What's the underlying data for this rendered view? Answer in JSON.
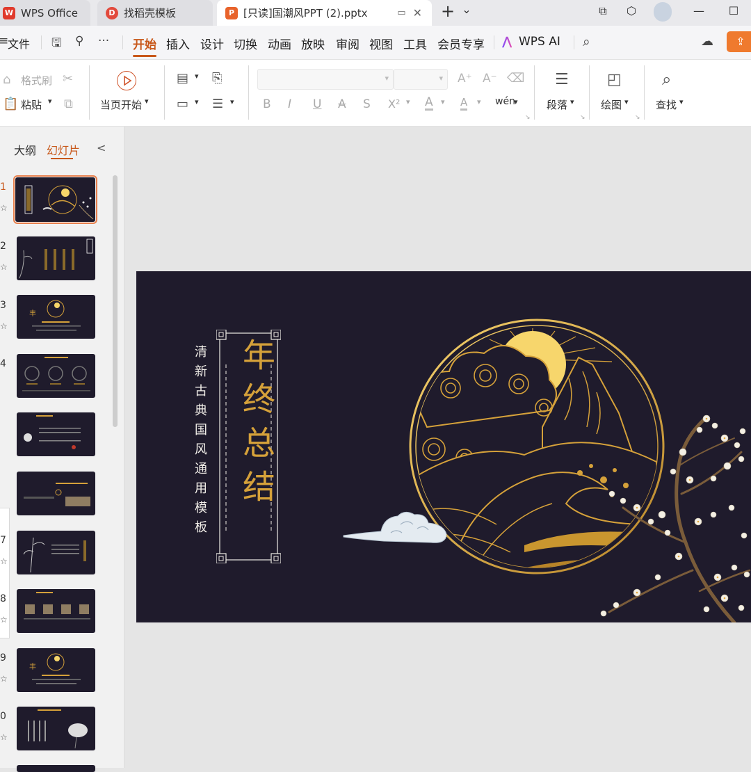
{
  "tabs": [
    {
      "label": "WPS Office",
      "icon_text": "W",
      "active": false
    },
    {
      "label": "找稻壳模板",
      "icon_text": "D",
      "active": false
    },
    {
      "label": "[只读]国潮风PPT (2).pptx",
      "icon_text": "P",
      "active": true
    }
  ],
  "tabbar": {
    "new_tab": "+",
    "dropdown": "⌄",
    "minimize": "—",
    "maximize": "☐"
  },
  "menu": {
    "file": "文件",
    "more": "···",
    "items": [
      "开始",
      "插入",
      "设计",
      "切换",
      "动画",
      "放映",
      "审阅",
      "视图",
      "工具",
      "会员专享"
    ],
    "ai_label": "WPS AI"
  },
  "ribbon": {
    "format_painter": "格式刷",
    "paste": "粘贴",
    "play_current": "当页开始",
    "paragraph": "段落",
    "draw": "绘图",
    "find": "查找",
    "font_buttons": [
      "B",
      "I",
      "U",
      "A",
      "S",
      "X²",
      "A",
      "A",
      "wén"
    ]
  },
  "sidepanel": {
    "tabs": [
      "大纲",
      "幻灯片"
    ],
    "collapse": "<",
    "slide_numbers": [
      "1",
      "2",
      "3",
      "4",
      "",
      "",
      "7",
      "8",
      "9",
      "0"
    ]
  },
  "slide": {
    "subtitle": "清新古典国风通用模板",
    "title": "年终总结"
  },
  "colors": {
    "accent": "#c8581a",
    "slide_bg": "#1f1b2c",
    "gold": "#d5a13a",
    "sun": "#f5d56a"
  }
}
